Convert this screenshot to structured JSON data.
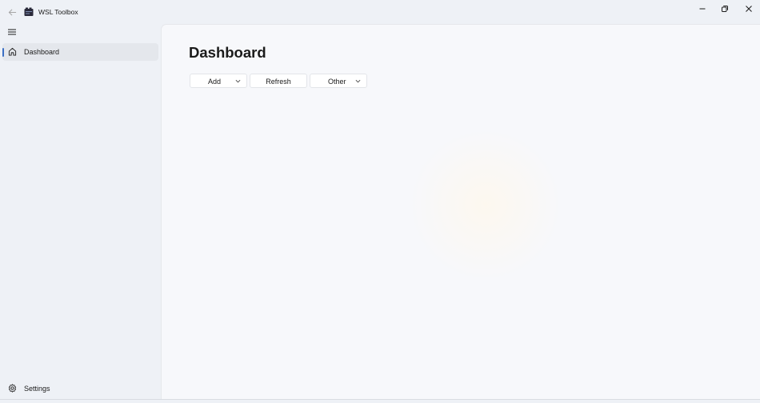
{
  "window": {
    "title": "WSL Toolbox"
  },
  "sidebar": {
    "items": [
      {
        "label": "Dashboard",
        "icon": "home-icon",
        "selected": true
      }
    ],
    "footer": {
      "label": "Settings",
      "icon": "gear-icon"
    }
  },
  "main": {
    "title": "Dashboard",
    "commands": [
      {
        "label": "Add",
        "has_dropdown": true
      },
      {
        "label": "Refresh",
        "has_dropdown": false
      },
      {
        "label": "Other",
        "has_dropdown": true
      }
    ]
  },
  "colors": {
    "accent": "#3b6fc4",
    "sidebar_bg": "#eef1f6",
    "content_bg": "#f7f8fb"
  }
}
